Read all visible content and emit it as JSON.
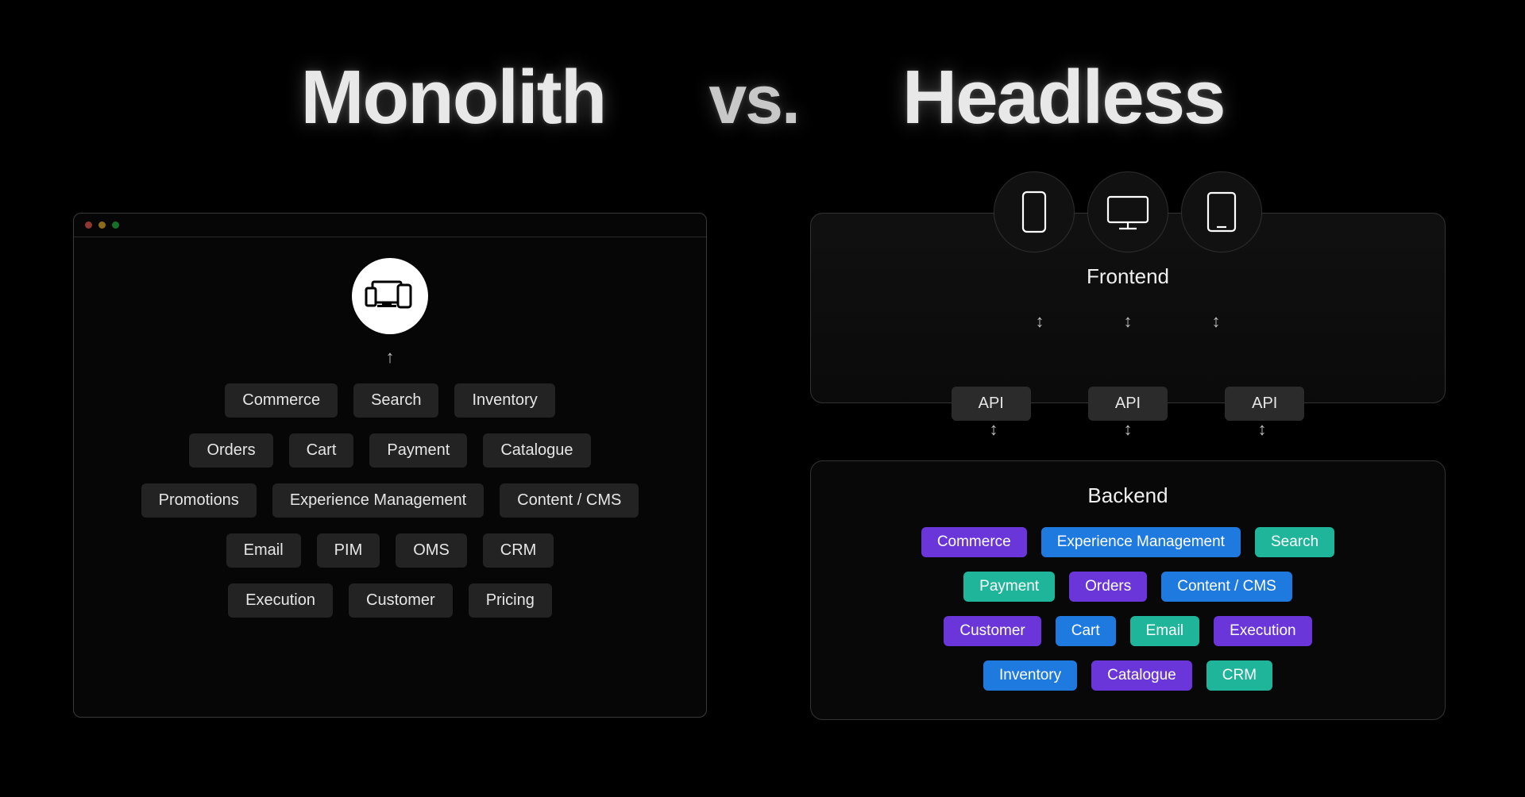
{
  "titles": {
    "left": "Monolith",
    "vs": "vs.",
    "right": "Headless"
  },
  "monolith": {
    "rows": [
      [
        "Commerce",
        "Search",
        "Inventory"
      ],
      [
        "Orders",
        "Cart",
        "Payment",
        "Catalogue"
      ],
      [
        "Promotions",
        "Experience Management",
        "Content / CMS"
      ],
      [
        "Email",
        "PIM",
        "OMS",
        "CRM"
      ],
      [
        "Execution",
        "Customer",
        "Pricing"
      ]
    ]
  },
  "headless": {
    "frontend_label": "Frontend",
    "api_label": "API",
    "backend_label": "Backend",
    "backend": [
      [
        {
          "t": "Commerce",
          "c": "purple"
        },
        {
          "t": "Experience Management",
          "c": "blue"
        },
        {
          "t": "Search",
          "c": "teal"
        }
      ],
      [
        {
          "t": "Payment",
          "c": "teal"
        },
        {
          "t": "Orders",
          "c": "purple"
        },
        {
          "t": "Content / CMS",
          "c": "blue"
        }
      ],
      [
        {
          "t": "Customer",
          "c": "purple"
        },
        {
          "t": "Cart",
          "c": "blue"
        },
        {
          "t": "Email",
          "c": "teal"
        },
        {
          "t": "Execution",
          "c": "purple"
        }
      ],
      [
        {
          "t": "Inventory",
          "c": "blue"
        },
        {
          "t": "Catalogue",
          "c": "purple"
        },
        {
          "t": "CRM",
          "c": "teal"
        }
      ]
    ]
  },
  "colors": {
    "purple": "#6a36d9",
    "blue": "#1f7ae0",
    "teal": "#1fb59a"
  }
}
